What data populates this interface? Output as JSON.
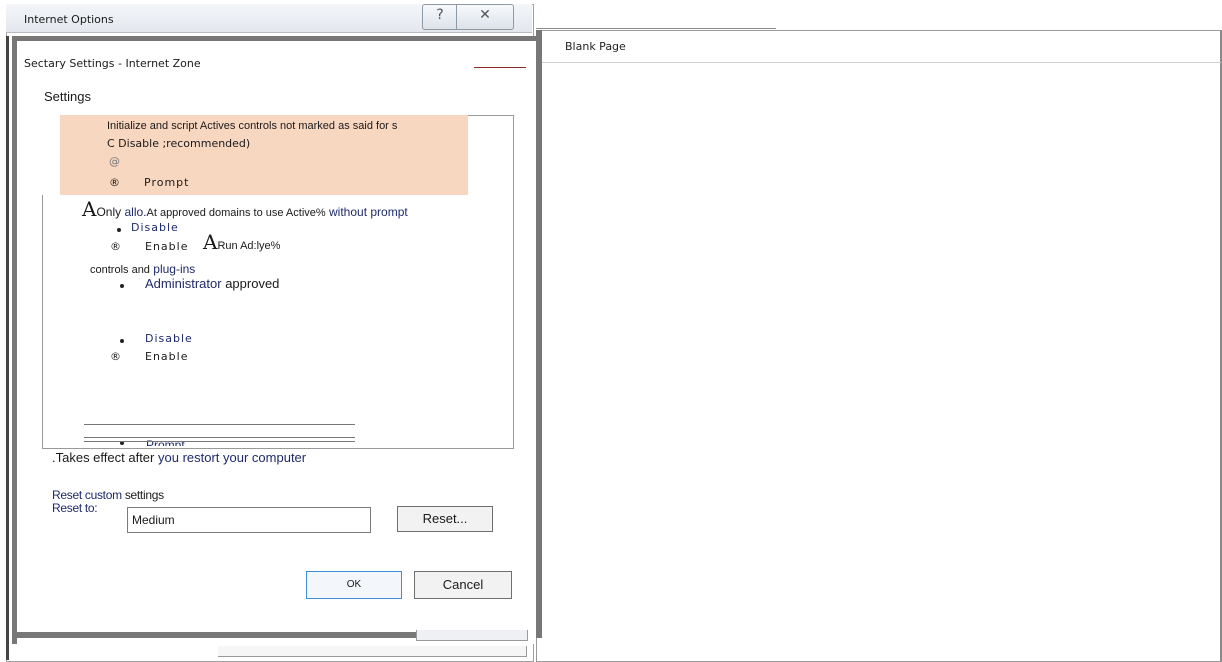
{
  "browser": {
    "page_title": "Blank Page"
  },
  "internet_options": {
    "title": "Internet Options",
    "help_glyph": "?",
    "close_glyph": "✕"
  },
  "dialog": {
    "title": "Sectary Settings - Internet Zone",
    "settings_label": "Settings",
    "items": {
      "h1": "Initialize and script Actives controls not marked as said for s",
      "h2": "C Disable ;recommended)",
      "h3": "@",
      "h4_glyph": "®",
      "h4_text": "Prompt",
      "only_A": "A",
      "only_1": "Only",
      "only_2": "allo.",
      "only_3": "At approved domains to use Active%",
      "only_4": "without prompt",
      "dis1": "Disable",
      "en1_glyph": "®",
      "en1_text": "Enable",
      "run_A": "A",
      "run_text": "Run Ad:lye%",
      "ctrl_1": "controls and",
      "ctrl_2": "plug-ins",
      "admin_1": "Administrator",
      "admin_2": "approved",
      "dis2": "Disable",
      "en2_glyph": "®",
      "en2_text": "Enable",
      "prompt_clip": "Prompt"
    },
    "restart_note": {
      "p1": ".Takes effect after",
      "p2": "you restort your computer"
    },
    "reset": {
      "heading_1": "Reset custom",
      "heading_2": "settings",
      "reset_to_label": "Reset to:",
      "value": "Medium",
      "button": "Reset..."
    },
    "ok_label": "OK",
    "cancel_label": "Cancel"
  }
}
